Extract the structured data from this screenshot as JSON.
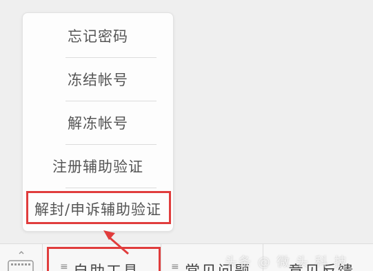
{
  "menu": {
    "items": [
      {
        "label": "忘记密码"
      },
      {
        "label": "冻结帐号"
      },
      {
        "label": "解冻帐号"
      },
      {
        "label": "注册辅助验证"
      },
      {
        "label": "解封/申诉辅助验证"
      }
    ]
  },
  "bottom_bar": {
    "keyboard_icon": "keyboard-icon",
    "tabs": [
      {
        "label": "自助工具",
        "icon": "menu-icon"
      },
      {
        "label": "常见问题",
        "icon": "menu-icon"
      },
      {
        "label": "意见反馈",
        "icon": ""
      }
    ]
  },
  "watermark": {
    "text": "头条 @ 微 头 科 技"
  },
  "colors": {
    "highlight": "#e03c3c",
    "background": "#efefef"
  }
}
